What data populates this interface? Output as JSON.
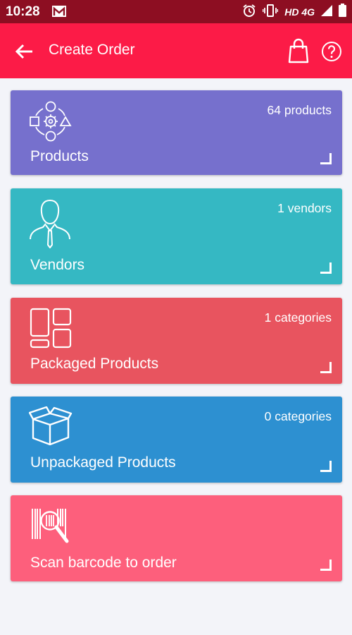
{
  "status_bar": {
    "time": "10:28",
    "network": "HD 4G",
    "icons": [
      "gmail-icon",
      "alarm-icon",
      "vibrate-icon",
      "signal-icon",
      "battery-icon"
    ]
  },
  "app_bar": {
    "title": "Create Order",
    "icons": [
      "back-arrow-icon",
      "shopping-bag-icon",
      "help-icon"
    ]
  },
  "colors": {
    "status_bar": "#8d0e22",
    "app_bar": "#fc1b47",
    "background": "#f3f4f9",
    "products": "#7670cd",
    "vendors": "#35b8c3",
    "packaged": "#e8545f",
    "unpackaged": "#2d90d1",
    "scan": "#fd5f7c"
  },
  "cards": {
    "products": {
      "label": "Products",
      "count": "64 products",
      "icon": "products-shapes-icon"
    },
    "vendors": {
      "label": "Vendors",
      "count": "1 vendors",
      "icon": "vendor-person-icon"
    },
    "packaged": {
      "label": "Packaged Products",
      "count": "1 categories",
      "icon": "packaged-grid-icon"
    },
    "unpackaged": {
      "label": "Unpackaged Products",
      "count": "0 categories",
      "icon": "open-box-icon"
    },
    "scan": {
      "label": "Scan barcode to order",
      "icon": "barcode-scan-icon"
    }
  }
}
